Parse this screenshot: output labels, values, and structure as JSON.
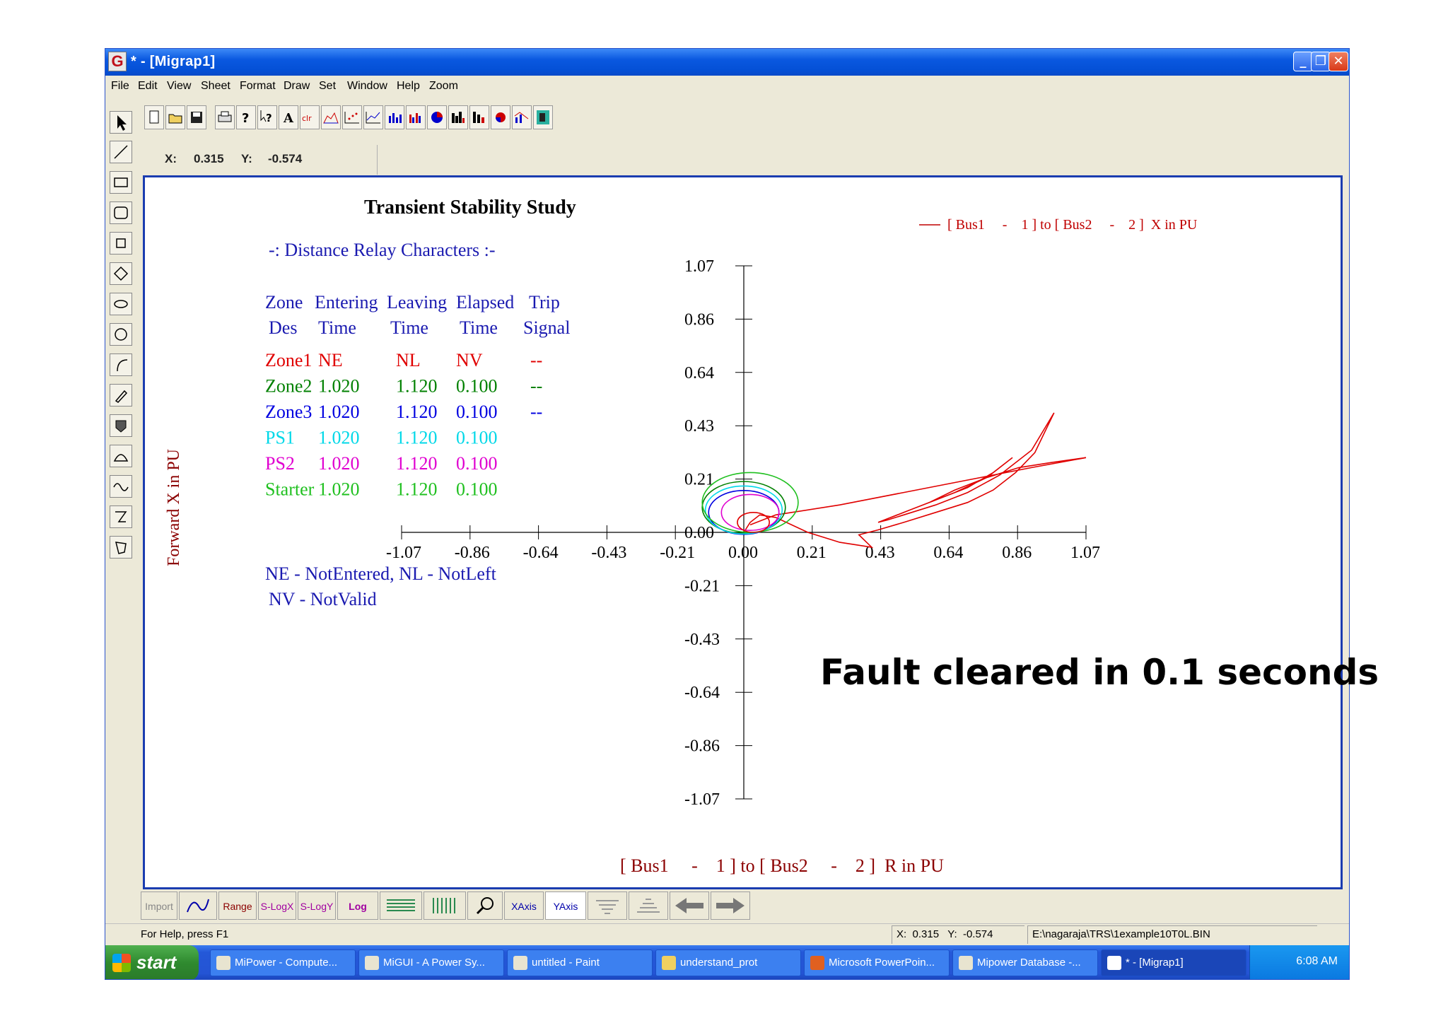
{
  "window": {
    "title": "* - [Migrap1]",
    "app_icon": "G"
  },
  "menu": [
    "File",
    "Edit",
    "View",
    "Sheet",
    "Format",
    "Draw",
    "Set",
    "Window",
    "Help",
    "Zoom"
  ],
  "coords": {
    "x_label": "X:",
    "x_value": "0.315",
    "y_label": "Y:",
    "y_value": "-0.574"
  },
  "plot": {
    "title": "Transient Stability Study",
    "legend": "[ Bus1     -    1 ] to [ Bus2     -    2 ]  X in PU",
    "relay_heading": "-: Distance Relay Characters :-",
    "table_header_1": [
      "Zone",
      "Entering",
      "Leaving",
      "Elapsed",
      "Trip"
    ],
    "table_header_2": [
      "Des",
      "Time",
      "Time",
      "Time",
      "Signal"
    ],
    "rows": [
      {
        "name": "Zone1",
        "enter": "NE",
        "leave": "NL",
        "elapsed": "NV",
        "trip": "--",
        "color": "#e00000"
      },
      {
        "name": "Zone2",
        "enter": "1.020",
        "leave": "1.120",
        "elapsed": "0.100",
        "trip": "--",
        "color": "#008000"
      },
      {
        "name": "Zone3",
        "enter": "1.020",
        "leave": "1.120",
        "elapsed": "0.100",
        "trip": "--",
        "color": "#0000e0"
      },
      {
        "name": "PS1",
        "enter": "1.020",
        "leave": "1.120",
        "elapsed": "0.100",
        "trip": "",
        "color": "#00d8e8"
      },
      {
        "name": "PS2",
        "enter": "1.020",
        "leave": "1.120",
        "elapsed": "0.100",
        "trip": "",
        "color": "#e000d0"
      },
      {
        "name": "Starter",
        "enter": "1.020",
        "leave": "1.120",
        "elapsed": "0.100",
        "trip": "",
        "color": "#20c020"
      }
    ],
    "note_1": "NE - NotEntered, NL - NotLeft",
    "note_2": "NV - NotValid",
    "ylabel": "Forward X in PU",
    "xlabel": "[ Bus1     -    1 ] to [ Bus2     -    2 ]  R in PU",
    "fault_text": "Fault cleared in 0.1 seconds"
  },
  "chart_data": {
    "type": "line",
    "title": "Transient Stability Study",
    "xlabel": "[ Bus1     -    1 ] to [ Bus2     -    2 ]  R in PU",
    "ylabel": "Forward X in PU",
    "xlim": [
      -1.07,
      1.07
    ],
    "ylim": [
      -1.07,
      1.07
    ],
    "x_ticks": [
      "-1.07",
      "-0.86",
      "-0.64",
      "-0.43",
      "-0.21",
      "0.00",
      "0.21",
      "0.43",
      "0.64",
      "0.86",
      "1.07"
    ],
    "y_ticks": [
      "1.07",
      "0.86",
      "0.64",
      "0.43",
      "0.21",
      "0.00",
      "-0.21",
      "-0.43",
      "-0.64",
      "-0.86",
      "-1.07"
    ],
    "series": [
      {
        "name": "[ Bus1     -    1 ] to [ Bus2     -    2 ]  X in PU",
        "color": "#e00000",
        "x": [
          0.0,
          0.02,
          0.05,
          0.1,
          0.2,
          0.3,
          0.4,
          0.36,
          0.42,
          0.5,
          0.6,
          0.7,
          0.78,
          0.85,
          0.91,
          0.97,
          0.9,
          0.8,
          0.7,
          0.6,
          0.5,
          0.45,
          0.42,
          0.48,
          0.56,
          0.66,
          0.76,
          0.84,
          0.78,
          0.7,
          0.6,
          0.52,
          0.46,
          0.5,
          0.58,
          0.66,
          0.76,
          0.86,
          0.96,
          1.07,
          0.9,
          0.7,
          0.5,
          0.3,
          0.1,
          0.02
        ],
        "y": [
          0.0,
          0.04,
          0.07,
          0.06,
          0.0,
          -0.04,
          -0.06,
          -0.01,
          0.01,
          0.04,
          0.08,
          0.12,
          0.17,
          0.24,
          0.32,
          0.48,
          0.33,
          0.23,
          0.16,
          0.11,
          0.07,
          0.05,
          0.04,
          0.07,
          0.11,
          0.16,
          0.22,
          0.3,
          0.24,
          0.18,
          0.13,
          0.09,
          0.06,
          0.08,
          0.12,
          0.17,
          0.22,
          0.26,
          0.28,
          0.3,
          0.26,
          0.21,
          0.16,
          0.11,
          0.07,
          0.03
        ]
      },
      {
        "name": "Zone2",
        "color": "#008000",
        "shape": "circle",
        "cx": 0.0,
        "cy": 0.1,
        "r": 0.13
      },
      {
        "name": "Zone3",
        "color": "#0000e0",
        "shape": "circle",
        "cx": 0.0,
        "cy": 0.08,
        "r": 0.11
      },
      {
        "name": "PS1",
        "color": "#00d8e8",
        "shape": "circle",
        "cx": 0.0,
        "cy": 0.09,
        "r": 0.12
      },
      {
        "name": "PS2",
        "color": "#e000d0",
        "shape": "circle",
        "cx": 0.02,
        "cy": 0.08,
        "r": 0.09
      },
      {
        "name": "Starter",
        "color": "#20c020",
        "shape": "circle",
        "cx": 0.02,
        "cy": 0.12,
        "r": 0.15
      },
      {
        "name": "Zone1",
        "color": "#e00000",
        "shape": "circle",
        "cx": 0.03,
        "cy": 0.04,
        "r": 0.05
      }
    ]
  },
  "bottom_toolbar": [
    "Import",
    "Range",
    "S-LogX",
    "S-LogY",
    "Log",
    "XAxis",
    "YAxis"
  ],
  "status": {
    "help": "For Help, press F1",
    "coords": "X:  0.315   Y:  -0.574",
    "file": "E:\\nagaraja\\TRS\\1example10T0L.BIN"
  },
  "taskbar": {
    "start": "start",
    "tasks": [
      "MiPower - Compute...",
      "MiGUI - A Power Sy...",
      "untitled - Paint",
      "understand_prot",
      "Microsoft PowerPoin...",
      "Mipower Database -...",
      "* - [Migrap1]"
    ],
    "clock": "6:08 AM"
  }
}
